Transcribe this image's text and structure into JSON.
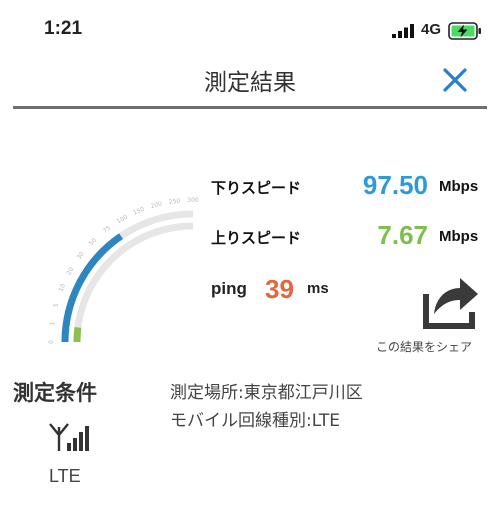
{
  "status_bar": {
    "time": "1:21",
    "network": "4G",
    "icons": [
      "signal-bars-icon",
      "battery-charging-icon"
    ],
    "battery_color": "#4cd964"
  },
  "header": {
    "title": "測定結果",
    "close_icon": "close-icon",
    "close_color": "#2b7cd3"
  },
  "gauge": {
    "ticks": [
      "0",
      "1",
      "5",
      "10",
      "20",
      "30",
      "50",
      "75",
      "100",
      "150",
      "200",
      "250",
      "300"
    ],
    "download_fraction": 0.62,
    "upload_fraction": 0.08,
    "download_color": "#2e86c1",
    "upload_color": "#8cc152",
    "track_color": "#e6e6e6"
  },
  "results": {
    "download": {
      "label": "下りスピード",
      "value": "97.50",
      "unit": "Mbps",
      "color": "#2e9bd6"
    },
    "upload": {
      "label": "上りスピード",
      "value": "7.67",
      "unit": "Mbps",
      "color": "#7fbf4d"
    },
    "ping": {
      "label": "ping",
      "value": "39",
      "unit": "ms",
      "color": "#e0683b"
    },
    "share": {
      "label": "この結果をシェア",
      "icon": "share-icon"
    }
  },
  "conditions": {
    "title": "測定条件",
    "network_icon": "antenna-signal-icon",
    "network_type": "LTE",
    "location": "測定場所:東京都江戸川区",
    "line_type": "モバイル回線種別:LTE"
  }
}
